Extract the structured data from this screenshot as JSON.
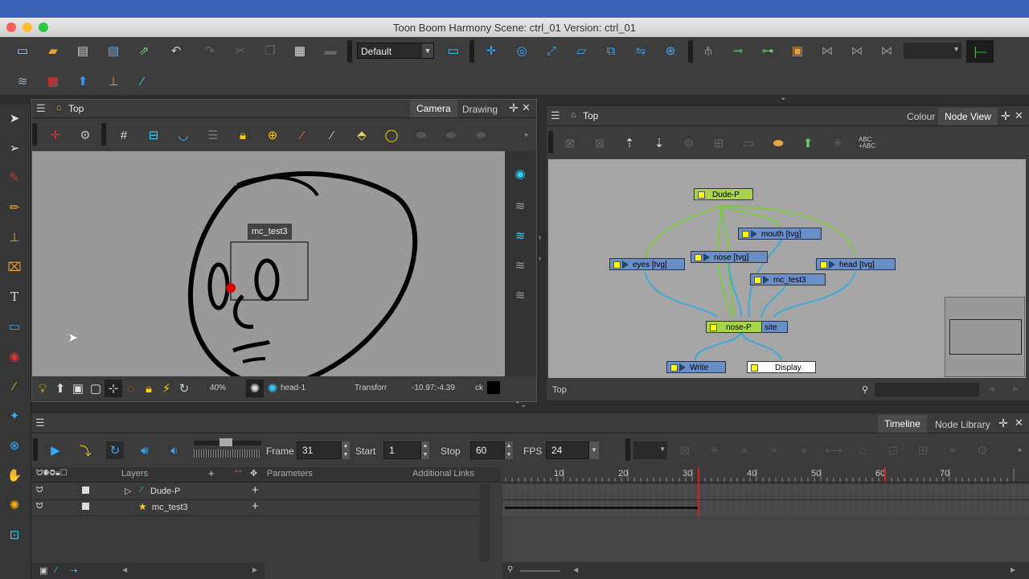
{
  "window": {
    "title": "Toon Boom Harmony Scene: ctrl_01 Version: ctrl_01"
  },
  "toolbar": {
    "workspace_select": "Default"
  },
  "camera_panel": {
    "breadcrumb": "Top",
    "tabs": [
      "Camera",
      "Drawing"
    ],
    "active_tab": "Camera",
    "canvas": {
      "peg_label": "mc_test3"
    },
    "statusbar": {
      "zoom": "40%",
      "drawing": "head-1",
      "tool": "Transforr",
      "coords": "-10.97:-4.39",
      "extra": "ck"
    }
  },
  "node_panel": {
    "breadcrumb": "Top",
    "tabs": [
      "Colour",
      "Node View"
    ],
    "active_tab": "Node View",
    "abc_label": "ABC\n+ABC",
    "nodes": {
      "dude_p": "Dude-P",
      "mouth": "mouth  [tvg]",
      "eyes": "eyes  [tvg]",
      "nose": "nose  [tvg]",
      "head": "head  [tvg]",
      "mc_test3": "mc_test3",
      "nose_p": "nose-P",
      "composite_tail": "site",
      "write": "Write",
      "display": "Display"
    },
    "footer": "Top"
  },
  "timeline_panel": {
    "tabs": [
      "Timeline",
      "Node Library"
    ],
    "active_tab": "Timeline",
    "frame_label": "Frame",
    "frame": "31",
    "start_label": "Start",
    "start": "1",
    "stop_label": "Stop",
    "stop": "60",
    "fps_label": "FPS",
    "fps": "24",
    "columns": {
      "layers": "Layers",
      "parameters": "Parameters",
      "links": "Additional Links"
    },
    "layers": [
      "Dude-P",
      "mc_test3"
    ],
    "ruler": [
      "10",
      "20",
      "30",
      "40",
      "50",
      "60",
      "70"
    ],
    "current_frame": 31,
    "stop_frame": 60
  },
  "colors": {
    "accent": "#cc2222",
    "node_green": "#a8d44a",
    "node_blue": "#6a8fc8",
    "wire_green": "#7ac943",
    "wire_blue": "#3fa9d9"
  }
}
